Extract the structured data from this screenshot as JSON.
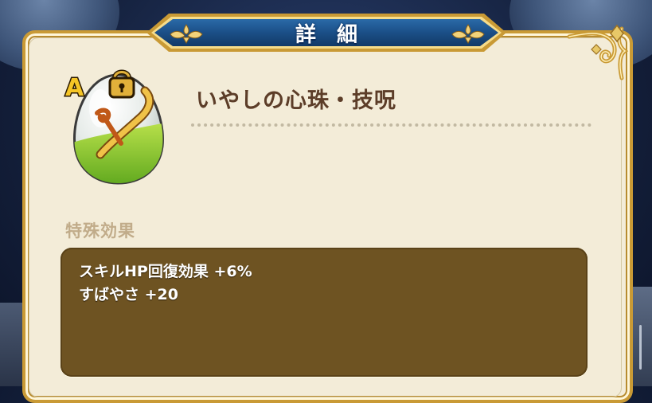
{
  "dialog": {
    "title": "詳細"
  },
  "item": {
    "name": "いやしの心珠・技呪",
    "rank": "A",
    "icon": "green-orb-with-golden-horn-icon",
    "locked": true
  },
  "special_effects": {
    "heading": "特殊効果",
    "lines": [
      "スキルHP回復効果 +6%",
      "すばやさ +20"
    ]
  },
  "colors": {
    "panel_bg": "#f3ecd8",
    "panel_border_gold": "#c99a35",
    "title_bar_blue": "#1b4f87",
    "name_text": "#5c3d28",
    "section_heading": "#c1ac8a",
    "effects_box_bg": "#6e5322",
    "rank_badge_yellow": "#f5c526"
  }
}
